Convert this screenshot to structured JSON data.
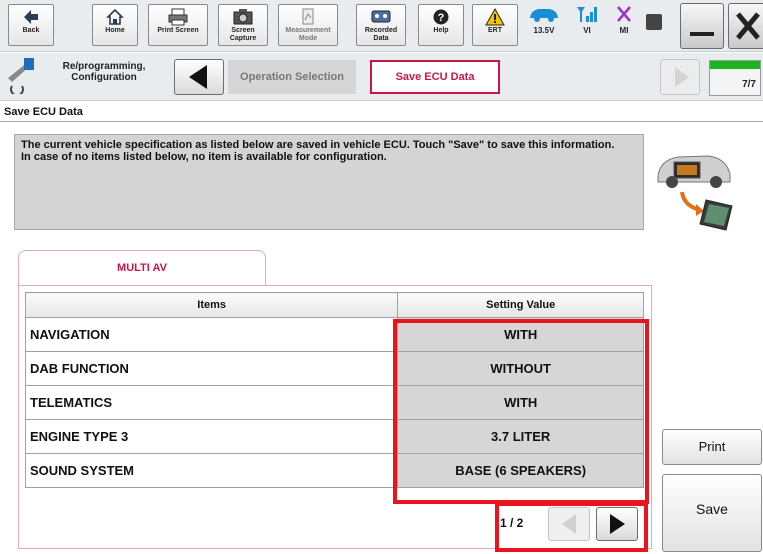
{
  "toolbar": {
    "buttons": [
      {
        "label": "Back",
        "icon": "back-arrow-icon"
      },
      {
        "label": "Home",
        "icon": "home-icon"
      },
      {
        "label": "Print Screen",
        "icon": "printer-icon"
      },
      {
        "label": "Screen Capture",
        "icon": "camera-icon"
      },
      {
        "label": "Measurement Mode",
        "icon": "measurement-icon"
      },
      {
        "label": "Recorded Data",
        "icon": "recorded-data-icon"
      },
      {
        "label": "Help",
        "icon": "help-icon"
      },
      {
        "label": "ERT",
        "icon": "warning-icon"
      }
    ],
    "status": {
      "voltage": "13.5V",
      "vi": "VI",
      "mi": "MI"
    }
  },
  "nav": {
    "section_label": "Re/programming, Configuration",
    "step1": "Operation Selection",
    "step2": "Save ECU Data",
    "progress": "7/7",
    "progress_fraction": 1.0
  },
  "page_title": "Save ECU Data",
  "info": {
    "line1": "The current vehicle specification as listed below are saved in vehicle ECU. Touch \"Save\" to save this information.",
    "line2": "In case of no items listed below, no item is available for configuration."
  },
  "tab_label": "MULTI AV",
  "table": {
    "headers": [
      "Items",
      "Setting Value"
    ],
    "rows": [
      {
        "item": "NAVIGATION",
        "value": "WITH"
      },
      {
        "item": "DAB FUNCTION",
        "value": "WITHOUT"
      },
      {
        "item": "TELEMATICS",
        "value": "WITH"
      },
      {
        "item": "ENGINE TYPE 3",
        "value": "3.7 LITER"
      },
      {
        "item": "SOUND SYSTEM",
        "value": "BASE (6 SPEAKERS)"
      }
    ]
  },
  "pager": {
    "label": "1 / 2"
  },
  "buttons": {
    "print": "Print",
    "save": "Save"
  },
  "colors": {
    "accent": "#c8164c",
    "highlight": "#e8141e"
  }
}
